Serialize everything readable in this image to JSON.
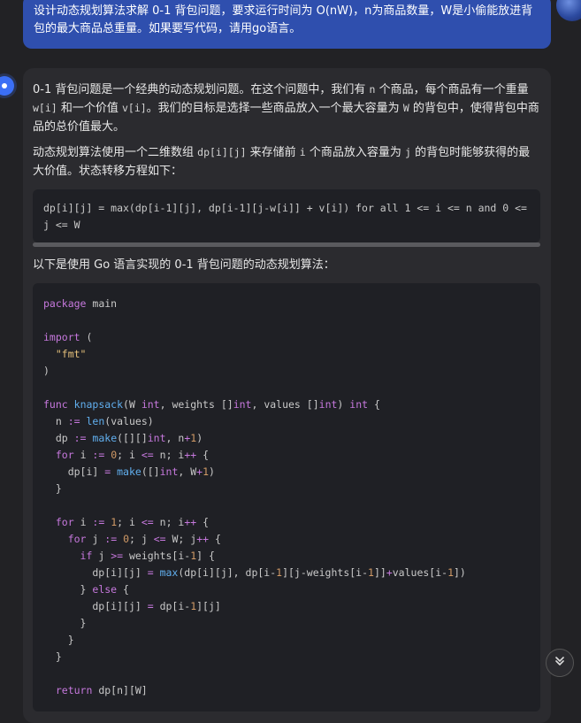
{
  "user_message": {
    "text": "设计动态规划算法求解 0-1 背包问题，要求运行时间为 O(nW)，n为商品数量，W是小偷能放进背包的最大商品总重量。如果要写代码，请用go语言。"
  },
  "answer": {
    "para1_a": "0-1 背包问题是一个经典的动态规划问题。在这个问题中，我们有 ",
    "para1_n": "n",
    "para1_b": " 个商品，每个商品有一个重量 ",
    "para1_wi": "w[i]",
    "para1_c": " 和一个价值 ",
    "para1_vi": "v[i]",
    "para1_d": "。我们的目标是选择一些商品放入一个最大容量为 ",
    "para1_W": "W",
    "para1_e": " 的背包中，使得背包中商品的总价值最大。",
    "para2_a": "动态规划算法使用一个二维数组 ",
    "para2_dp": "dp[i][j]",
    "para2_b": " 来存储前 ",
    "para2_i": "i",
    "para2_c": " 个商品放入容量为 ",
    "para2_j": "j",
    "para2_d": " 的背包时能够获得的最大价值。状态转移方程如下：",
    "formula": "dp[i][j] = max(dp[i-1][j], dp[i-1][j-w[i]] + v[i]) for all 1 <= i <= n and 0 <= j <= W",
    "para3": "以下是使用 Go 语言实现的 0-1 背包问题的动态规划算法："
  },
  "code": {
    "language": "go",
    "lines": [
      "package main",
      "",
      "import (",
      "  \"fmt\"",
      ")",
      "",
      "func knapsack(W int, weights []int, values []int) int {",
      "  n := len(values)",
      "  dp := make([][]int, n+1)",
      "  for i := 0; i <= n; i++ {",
      "    dp[i] = make([]int, W+1)",
      "  }",
      "",
      "  for i := 1; i <= n; i++ {",
      "    for j := 0; j <= W; j++ {",
      "      if j >= weights[i-1] {",
      "        dp[i][j] = max(dp[i][j], dp[i-1][j-weights[i-1]]+values[i-1])",
      "      } else {",
      "        dp[i][j] = dp[i-1][j]",
      "      }",
      "    }",
      "  }",
      "",
      "  return dp[n][W]"
    ]
  },
  "icons": {
    "scroll_down": "double-chevron-down-icon",
    "assistant": "assistant-dot-icon",
    "user": "user-avatar"
  },
  "colors": {
    "user_bubble": "#2f4fae",
    "card": "#2b2b2f",
    "code_bg": "#1f2025",
    "keyword": "#c678dd",
    "function": "#61afef",
    "string": "#e5c07b"
  }
}
